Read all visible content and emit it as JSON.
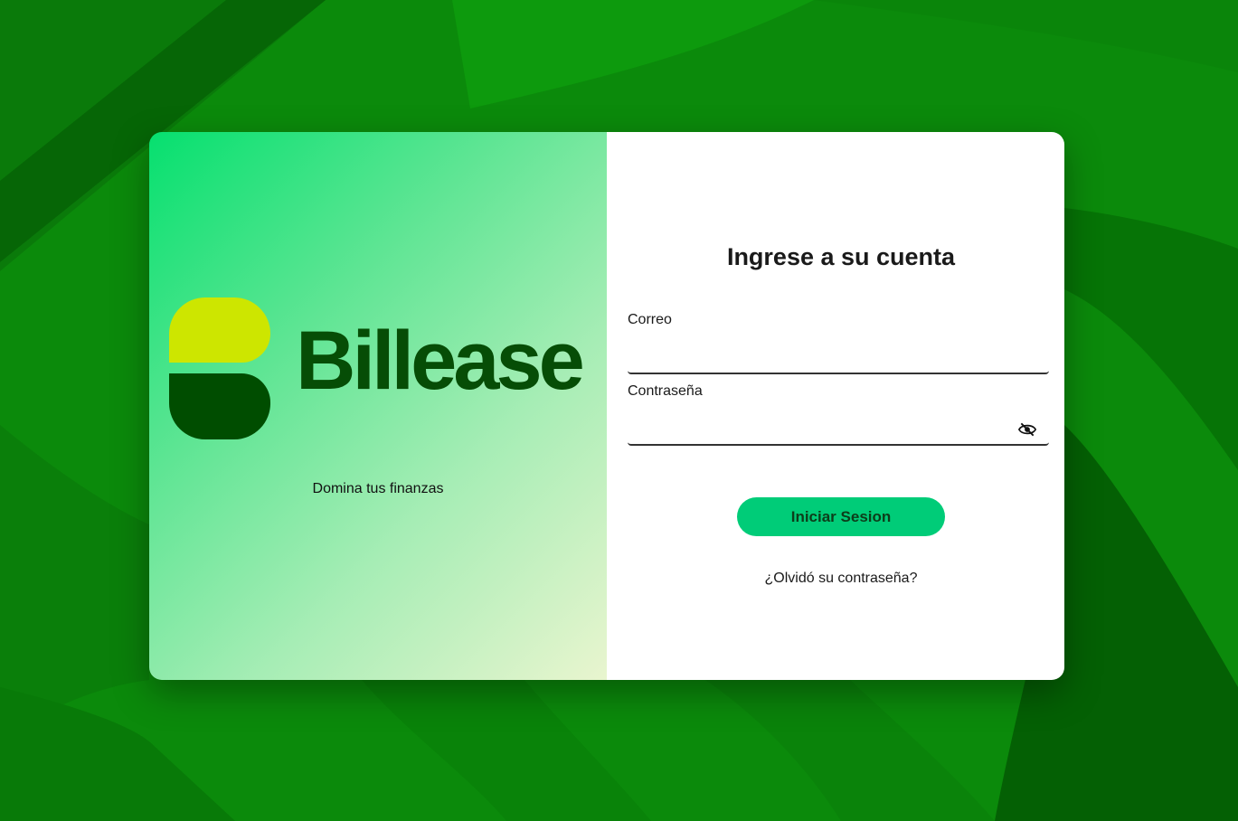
{
  "brand": {
    "name": "Billease",
    "tagline": "Domina tus finanzas",
    "colors": {
      "logo_top": "#cde600",
      "logo_bottom": "#004d00",
      "wordmark": "#064d06",
      "accent_button": "#00cc78",
      "background": "#0b8a0b"
    }
  },
  "login_form": {
    "title": "Ingrese a su cuenta",
    "email_label": "Correo",
    "email_value": "",
    "password_label": "Contraseña",
    "password_value": "",
    "password_toggle_icon": "eye-slash-icon",
    "submit_label": "Iniciar Sesion",
    "forgot_label": "¿Olvidó su contraseña?"
  }
}
